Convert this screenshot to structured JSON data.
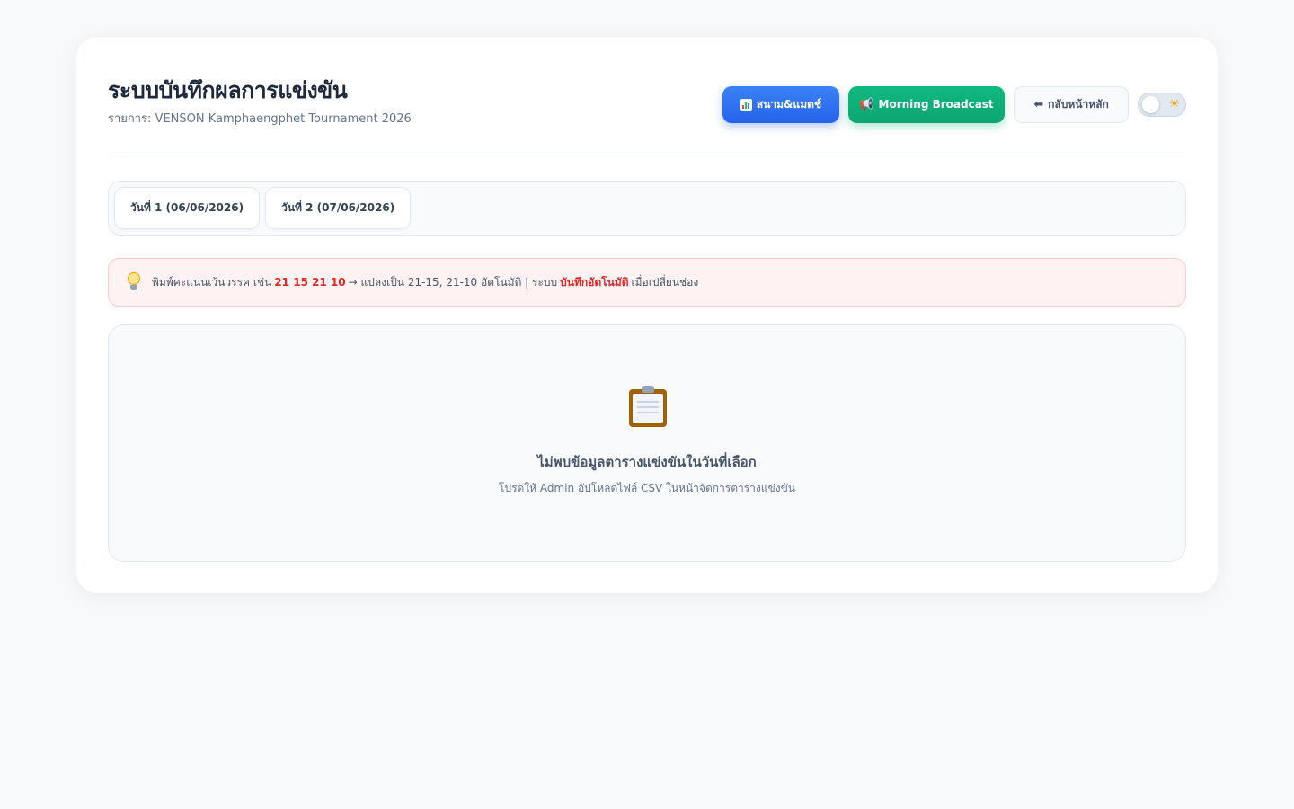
{
  "header": {
    "title": "ระบบบันทึกผลการแข่งขัน",
    "subtitle": "รายการ: VENSON Kamphaengphet Tournament 2026"
  },
  "actions": {
    "courts_label": "สนาม&แมตช์",
    "courts_icon": "bar-chart-icon",
    "broadcast_label": "Morning Broadcast",
    "broadcast_icon": "megaphone-icon",
    "back_label": "กลับหน้าหลัก",
    "back_icon": "arrow-left-icon",
    "theme_icon": "sun-icon",
    "theme_glyph": "☀"
  },
  "tabs": [
    {
      "label": "วันที่ 1 (06/06/2026)"
    },
    {
      "label": "วันที่ 2 (07/06/2026)"
    }
  ],
  "hint": {
    "icon": "lightbulb-icon",
    "part1": "พิมพ์คะแนนเว้นวรรค เช่น",
    "example": "21 15 21 10",
    "part2": "→ แปลงเป็น 21-15, 21-10 อัตโนมัติ | ระบบ",
    "autosave": "บันทึกอัตโนมัติ",
    "part3": "เมื่อเปลี่ยนช่อง"
  },
  "empty_state": {
    "icon": "clipboard-icon",
    "title": "ไม่พบข้อมูลตารางแข่งขันในวันที่เลือก",
    "message": "โปรดให้ Admin อัปโหลดไฟล์ CSV ในหน้าจัดการตารางแข่งขัน"
  },
  "colors": {
    "primary": "#2563eb",
    "success": "#10b981",
    "highlight": "#dc2626",
    "page_bg": "#f8f9fb"
  }
}
